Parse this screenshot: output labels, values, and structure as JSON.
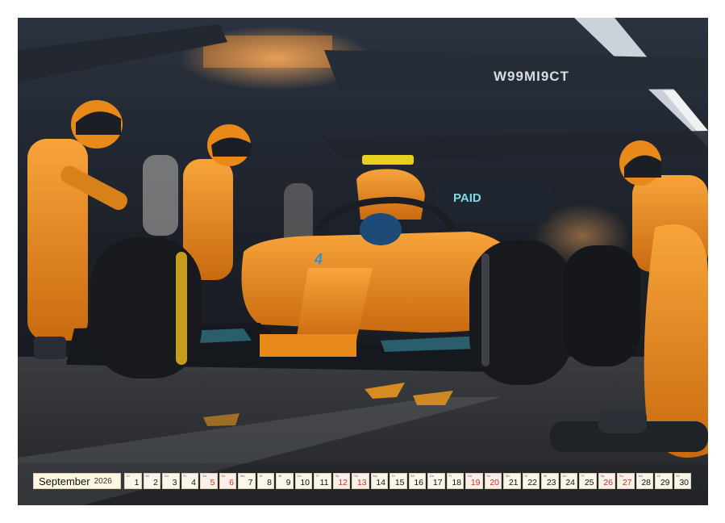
{
  "calendar": {
    "month": "September",
    "year": "2026",
    "days": [
      {
        "n": "1",
        "wd": "Di",
        "weekend": false
      },
      {
        "n": "2",
        "wd": "Mi",
        "weekend": false
      },
      {
        "n": "3",
        "wd": "Do",
        "weekend": false
      },
      {
        "n": "4",
        "wd": "Fr",
        "weekend": false
      },
      {
        "n": "5",
        "wd": "Sa",
        "weekend": true
      },
      {
        "n": "6",
        "wd": "So",
        "weekend": true
      },
      {
        "n": "7",
        "wd": "Mo",
        "weekend": false
      },
      {
        "n": "8",
        "wd": "Di",
        "weekend": false
      },
      {
        "n": "9",
        "wd": "Mi",
        "weekend": false
      },
      {
        "n": "10",
        "wd": "Do",
        "weekend": false
      },
      {
        "n": "11",
        "wd": "Fr",
        "weekend": false
      },
      {
        "n": "12",
        "wd": "Sa",
        "weekend": true
      },
      {
        "n": "13",
        "wd": "So",
        "weekend": true
      },
      {
        "n": "14",
        "wd": "Mo",
        "weekend": false
      },
      {
        "n": "15",
        "wd": "Di",
        "weekend": false
      },
      {
        "n": "16",
        "wd": "Mi",
        "weekend": false
      },
      {
        "n": "17",
        "wd": "Do",
        "weekend": false
      },
      {
        "n": "18",
        "wd": "Fr",
        "weekend": false
      },
      {
        "n": "19",
        "wd": "Sa",
        "weekend": true
      },
      {
        "n": "20",
        "wd": "So",
        "weekend": true
      },
      {
        "n": "21",
        "wd": "Mo",
        "weekend": false
      },
      {
        "n": "22",
        "wd": "Di",
        "weekend": false
      },
      {
        "n": "23",
        "wd": "Mi",
        "weekend": false
      },
      {
        "n": "24",
        "wd": "Do",
        "weekend": false
      },
      {
        "n": "25",
        "wd": "Fr",
        "weekend": false
      },
      {
        "n": "26",
        "wd": "Sa",
        "weekend": true
      },
      {
        "n": "27",
        "wd": "So",
        "weekend": true
      },
      {
        "n": "28",
        "wd": "Mo",
        "weekend": false
      },
      {
        "n": "29",
        "wd": "Di",
        "weekend": false
      },
      {
        "n": "30",
        "wd": "Mi",
        "weekend": false
      }
    ]
  },
  "photo": {
    "overhead_sign": "W99MI9CT",
    "wing_text": "PAID",
    "car_number": "4"
  },
  "colors": {
    "papaya": "#e8891a",
    "asphalt": "#2a2c30",
    "weekend": "#c0392b"
  }
}
